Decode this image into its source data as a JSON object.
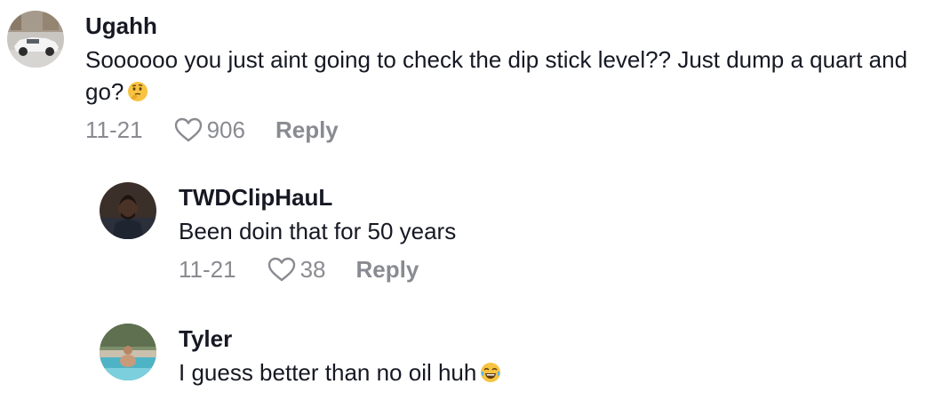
{
  "comments": [
    {
      "username": "Ugahh",
      "text": "Soooooo you just aint going to check the dip stick level?? Just dump a quart and go?",
      "emoji": "thinking-face-emoji",
      "date": "11-21",
      "likes": "906",
      "reply_label": "Reply"
    },
    {
      "username": "TWDClipHauL",
      "text": "Been doin that for 50 years",
      "date": "11-21",
      "likes": "38",
      "reply_label": "Reply"
    },
    {
      "username": "Tyler",
      "text": "I guess better than no oil huh",
      "emoji": "tears-of-joy-emoji"
    }
  ],
  "colors": {
    "text_primary": "#161823",
    "text_secondary": "#8a8b91"
  }
}
